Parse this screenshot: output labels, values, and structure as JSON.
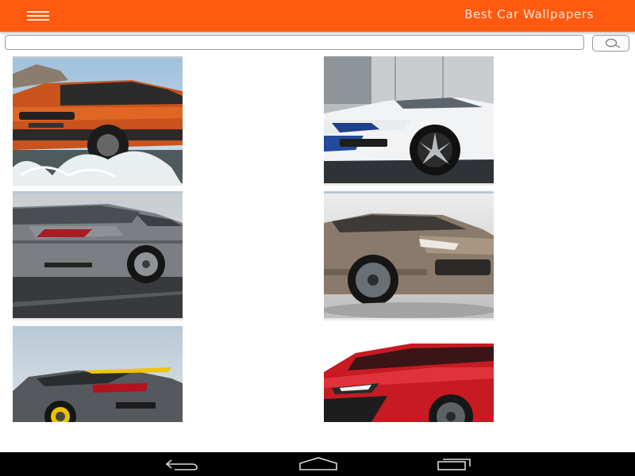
{
  "appbar": {
    "title": "Best Car Wallpapers",
    "menu_icon": "hamburger-menu-icon",
    "color": "#ff5a0f"
  },
  "search": {
    "value": "",
    "placeholder": "",
    "button_icon": "search-icon"
  },
  "wallpapers": [
    {
      "subject": "orange compact SUV splashing through water"
    },
    {
      "subject": "white sports sedan with blue livery"
    },
    {
      "subject": "grey sedan rear three-quarter view"
    },
    {
      "subject": "bronze SUV front three-quarter view"
    },
    {
      "subject": "grey coupe with yellow brake calipers"
    },
    {
      "subject": "red hatchback front view"
    }
  ],
  "navbar": {
    "back_icon": "back-icon",
    "home_icon": "home-icon",
    "recents_icon": "recent-apps-icon"
  }
}
